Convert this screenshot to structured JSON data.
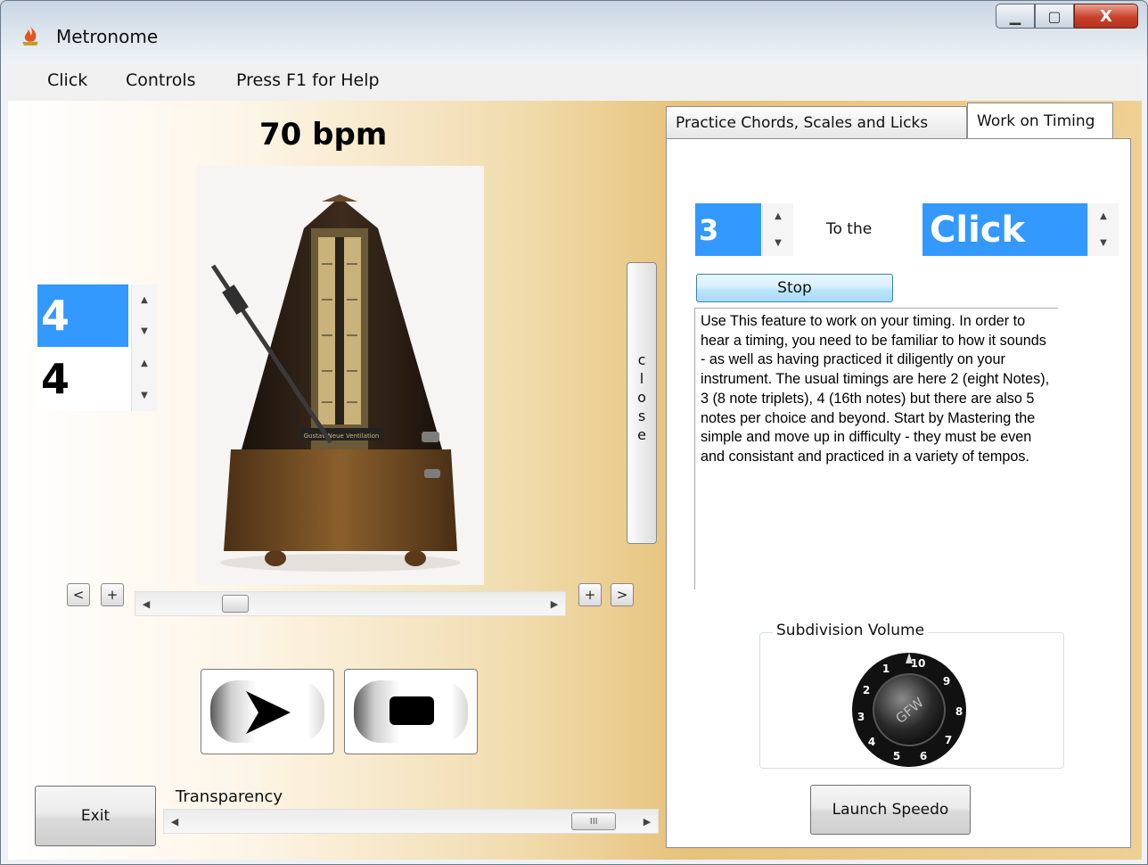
{
  "window": {
    "title": "Metronome",
    "minimize_glyph": "▁",
    "maximize_glyph": "▢",
    "close_glyph": "X"
  },
  "menu": {
    "items": [
      "Click",
      "Controls",
      "Press F1 for Help"
    ]
  },
  "tempo": {
    "label": "70 bpm",
    "slider_fraction": 0.18
  },
  "time_signature": {
    "beats": "4",
    "unit": "4"
  },
  "tempo_controls": {
    "decrease": "<",
    "plus_left": "+",
    "plus_right": "+",
    "increase": ">"
  },
  "photo": {
    "plate_text": "Gustav Neue Ventilation"
  },
  "close_panel": {
    "label": "close",
    "letters": [
      "c",
      "l",
      "o",
      "s",
      "e"
    ]
  },
  "transport": {
    "play_icon": "play-icon",
    "stop_icon": "stop-icon"
  },
  "exit_button": "Exit",
  "transparency": {
    "label": "Transparency",
    "fraction": 0.95,
    "thumb_glyph": "III"
  },
  "tabs": [
    {
      "label": "Practice Chords, Scales and Licks",
      "active": false
    },
    {
      "label": "Work on Timing",
      "active": true
    }
  ],
  "timing": {
    "subdivision": "3",
    "to_the_label": "To the",
    "target": "Click",
    "stop_label": "Stop",
    "description": "Use This feature to work on your timing.  In order to hear a timing, you need to be familiar to how it sounds - as well as having practiced it diligently on your instrument. The usual timings are here 2 (eight Notes), 3 (8 note triplets), 4 (16th notes) but there are also 5 notes per choice and beyond. Start by Mastering the simple and move up in difficulty - they must be even and consistant and practiced in a variety of tempos."
  },
  "subdivision_volume": {
    "label": "Subdivision Volume",
    "knob_center": "GFW",
    "knob_marks": [
      "10",
      "9",
      "8",
      "7",
      "6",
      "5",
      "4",
      "3",
      "2",
      "1"
    ]
  },
  "launch_speedo": "Launch Speedo",
  "colors": {
    "selection": "#3399ff",
    "gradient_gold": "#e6c27a"
  }
}
